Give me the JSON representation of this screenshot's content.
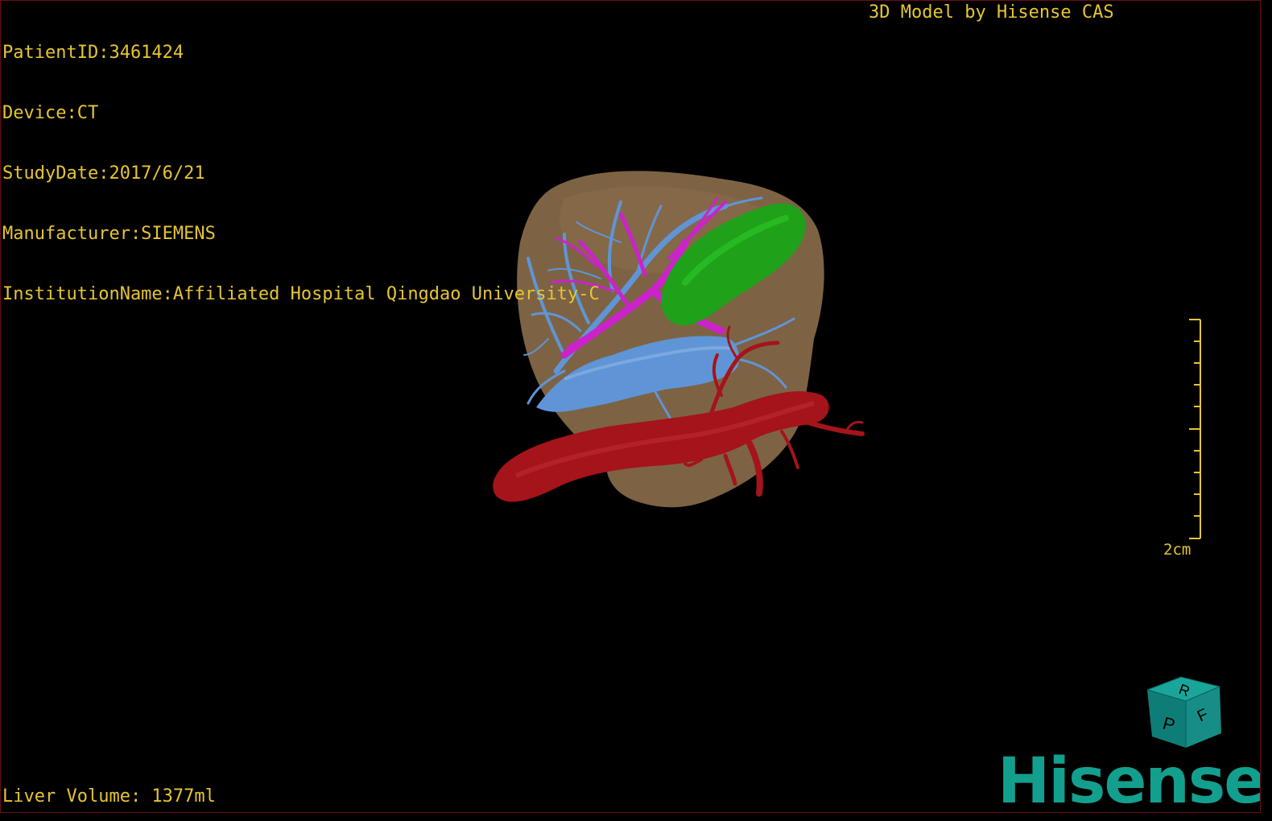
{
  "overlay": {
    "patient_id": "PatientID:3461424",
    "device": "Device:CT",
    "study_date": "StudyDate:2017/6/21",
    "manufacturer": "Manufacturer:SIEMENS",
    "institution": "InstitutionName:Affiliated Hospital Qingdao University-C",
    "model_credit": "3D Model by Hisense CAS",
    "liver_volume": "Liver Volume: 1377ml"
  },
  "scale_bar": {
    "label": "2cm"
  },
  "orientation_cube": {
    "faces": [
      "R",
      "F",
      "P"
    ],
    "icon": "orientation-cube-icon"
  },
  "logo": {
    "text": "Hisense",
    "color": "#139f8e"
  },
  "colors": {
    "text": "#e6c533",
    "liver": "#7d6344",
    "portal_vein": "#cc22cc",
    "hepatic_vein": "#5f95d6",
    "gallbladder": "#1fa11a",
    "artery": "#a4141a",
    "background": "#000000"
  }
}
